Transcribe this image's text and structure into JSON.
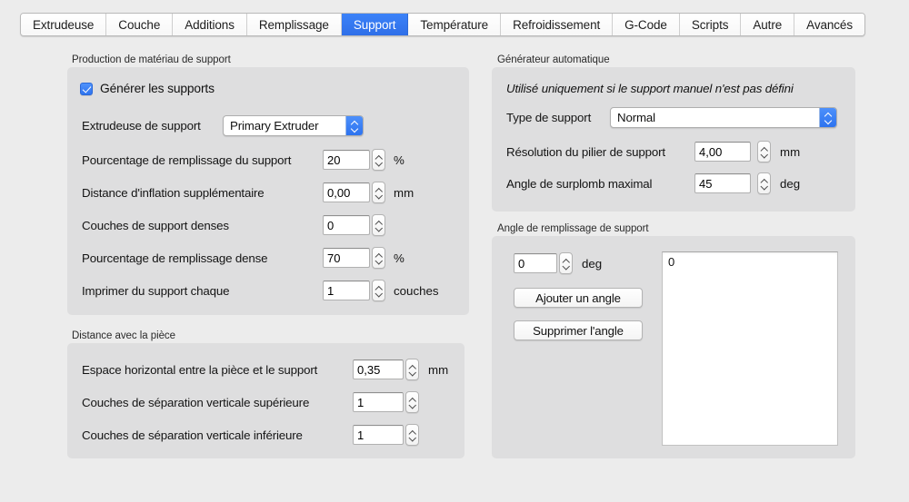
{
  "window": {
    "background_color": "#ececec",
    "accent_color": "#2f74ef"
  },
  "tabs": [
    {
      "label": "Extrudeuse",
      "selected": false
    },
    {
      "label": "Couche",
      "selected": false
    },
    {
      "label": "Additions",
      "selected": false
    },
    {
      "label": "Remplissage",
      "selected": false
    },
    {
      "label": "Support",
      "selected": true
    },
    {
      "label": "Température",
      "selected": false
    },
    {
      "label": "Refroidissement",
      "selected": false
    },
    {
      "label": "G-Code",
      "selected": false
    },
    {
      "label": "Scripts",
      "selected": false
    },
    {
      "label": "Autre",
      "selected": false
    },
    {
      "label": "Avancés",
      "selected": false
    }
  ],
  "groups": {
    "production": {
      "title": "Production de matériau de support",
      "checkbox": {
        "label": "Générer les supports",
        "checked": true
      },
      "extruder": {
        "label": "Extrudeuse de support",
        "value": "Primary Extruder"
      },
      "rows": [
        {
          "label": "Pourcentage de remplissage du support",
          "value": "20",
          "unit": "%"
        },
        {
          "label": "Distance d'inflation supplémentaire",
          "value": "0,00",
          "unit": "mm"
        },
        {
          "label": "Couches de support denses",
          "value": "0",
          "unit": ""
        },
        {
          "label": "Pourcentage de remplissage dense",
          "value": "70",
          "unit": "%"
        },
        {
          "label": "Imprimer du support chaque",
          "value": "1",
          "unit": "couches"
        }
      ]
    },
    "distance": {
      "title": "Distance avec la pièce",
      "rows": [
        {
          "label": "Espace horizontal entre la pièce et le support",
          "value": "0,35",
          "unit": "mm"
        },
        {
          "label": "Couches de séparation verticale supérieure",
          "value": "1",
          "unit": ""
        },
        {
          "label": "Couches de séparation verticale inférieure",
          "value": "1",
          "unit": ""
        }
      ]
    },
    "generator": {
      "title": "Générateur automatique",
      "note": "Utilisé uniquement si le support manuel n'est pas défini",
      "type": {
        "label": "Type de support",
        "value": "Normal"
      },
      "rows": [
        {
          "label": "Résolution du pilier de support",
          "value": "4,00",
          "unit": "mm"
        },
        {
          "label": "Angle de surplomb maximal",
          "value": "45",
          "unit": "deg"
        }
      ]
    },
    "angle": {
      "title": "Angle de remplissage de support",
      "spinner": {
        "value": "0",
        "unit": "deg"
      },
      "add_button": "Ajouter un angle",
      "remove_button": "Supprimer l'angle",
      "list": [
        "0"
      ]
    }
  }
}
